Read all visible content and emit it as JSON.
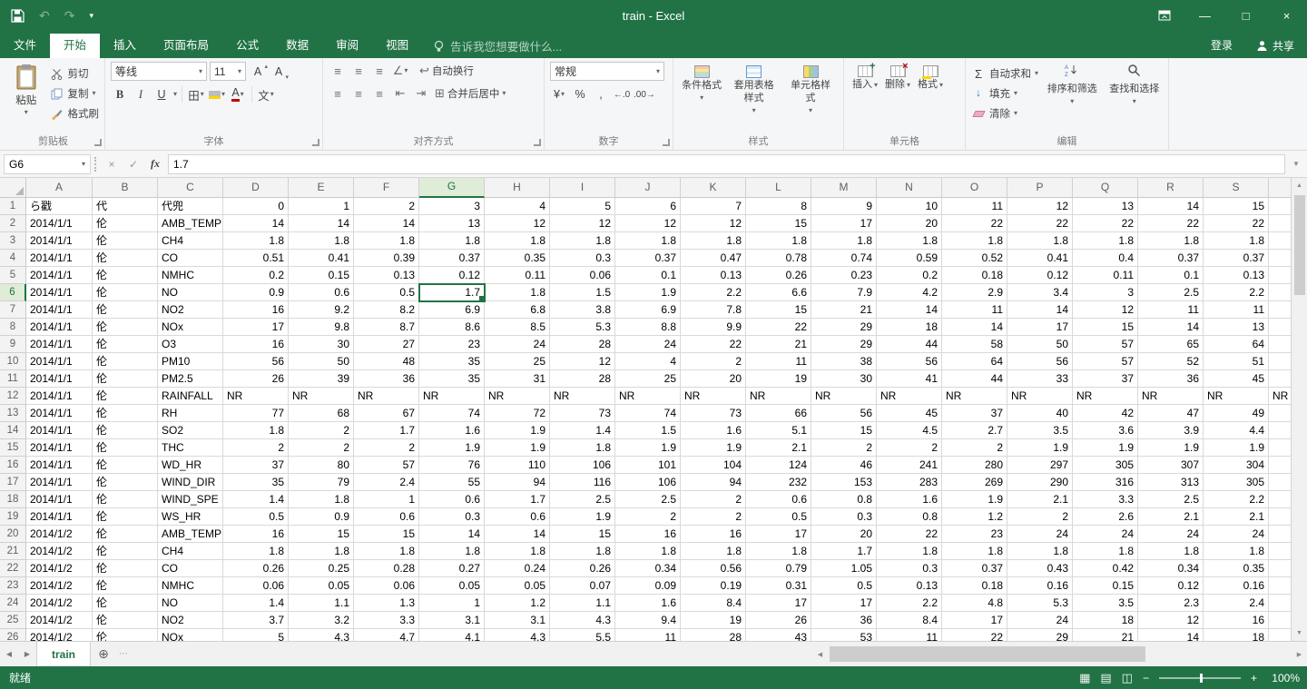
{
  "window": {
    "title": "train - Excel",
    "signin": "登录",
    "share": "共享"
  },
  "icons": {
    "chevron": "▾",
    "undo": "↶",
    "redo": "↷",
    "minimize": "—",
    "maximize": "□",
    "close": "×",
    "cancel": "×",
    "check": "✓",
    "bold": "B",
    "italic": "I",
    "underline": "U",
    "borders": "田",
    "phonetic": "文",
    "font_color_a": "A",
    "grow_font": "A",
    "shrink_font": "A",
    "align_lines": "≡",
    "orientation": "∠",
    "indent_dec": "⇤",
    "indent_inc": "⇥",
    "wrap": "↩",
    "merge": "⊞",
    "currency": "¥",
    "percent": "%",
    "comma": ",",
    "inc_decimal": "←.0",
    "dec_decimal": ".00→",
    "sum": "Σ",
    "fill_down": "↓",
    "left_arrow": "◀",
    "right_arrow": "▶",
    "up_arrow": "▲",
    "down_arrow": "▼",
    "add_sheet": "⊕",
    "ellipsis": "⋯",
    "view_normal": "▦",
    "view_layout": "▤",
    "view_break": "◫",
    "minus": "−",
    "plus": "+"
  },
  "ribbon": {
    "tabs": [
      "文件",
      "开始",
      "插入",
      "页面布局",
      "公式",
      "数据",
      "审阅",
      "视图"
    ],
    "active_tab": "开始",
    "tell_me": "告诉我您想要做什么...",
    "clipboard": {
      "label": "剪贴板",
      "paste": "粘贴",
      "cut": "剪切",
      "copy": "复制",
      "format_painter": "格式刷"
    },
    "font": {
      "label": "字体",
      "font_name": "等线",
      "font_size": "11"
    },
    "alignment": {
      "label": "对齐方式",
      "wrap_text": "自动换行",
      "merge_center": "合并后居中"
    },
    "number": {
      "label": "数字",
      "format": "常规"
    },
    "styles": {
      "label": "样式",
      "conditional": "条件格式",
      "format_as_table": "套用表格样式",
      "cell_styles": "单元格样式"
    },
    "cells": {
      "label": "单元格",
      "insert": "插入",
      "delete": "删除",
      "format": "格式"
    },
    "editing": {
      "label": "编辑",
      "autosum": "自动求和",
      "fill": "填充",
      "clear": "清除",
      "sort_filter": "排序和筛选",
      "find_select": "查找和选择"
    }
  },
  "formula_bar": {
    "name_box": "G6",
    "fx": "fx",
    "value": "1.7"
  },
  "grid": {
    "selected_cell": "G6",
    "selected_col": "G",
    "selected_row": 6,
    "columns": [
      "A",
      "B",
      "C",
      "D",
      "E",
      "F",
      "G",
      "H",
      "I",
      "J",
      "K",
      "L",
      "M",
      "N",
      "O",
      "P",
      "Q",
      "R",
      "S"
    ],
    "rows": [
      [
        "ら戳",
        "代",
        "代兜",
        "0",
        "1",
        "2",
        "3",
        "4",
        "5",
        "6",
        "7",
        "8",
        "9",
        "10",
        "11",
        "12",
        "13",
        "14",
        "15"
      ],
      [
        "2014/1/1",
        "伦",
        "AMB_TEMP",
        "14",
        "14",
        "14",
        "13",
        "12",
        "12",
        "12",
        "12",
        "15",
        "17",
        "20",
        "22",
        "22",
        "22",
        "22",
        "22"
      ],
      [
        "2014/1/1",
        "伦",
        "CH4",
        "1.8",
        "1.8",
        "1.8",
        "1.8",
        "1.8",
        "1.8",
        "1.8",
        "1.8",
        "1.8",
        "1.8",
        "1.8",
        "1.8",
        "1.8",
        "1.8",
        "1.8",
        "1.8"
      ],
      [
        "2014/1/1",
        "伦",
        "CO",
        "0.51",
        "0.41",
        "0.39",
        "0.37",
        "0.35",
        "0.3",
        "0.37",
        "0.47",
        "0.78",
        "0.74",
        "0.59",
        "0.52",
        "0.41",
        "0.4",
        "0.37",
        "0.37"
      ],
      [
        "2014/1/1",
        "伦",
        "NMHC",
        "0.2",
        "0.15",
        "0.13",
        "0.12",
        "0.11",
        "0.06",
        "0.1",
        "0.13",
        "0.26",
        "0.23",
        "0.2",
        "0.18",
        "0.12",
        "0.11",
        "0.1",
        "0.13"
      ],
      [
        "2014/1/1",
        "伦",
        "NO",
        "0.9",
        "0.6",
        "0.5",
        "1.7",
        "1.8",
        "1.5",
        "1.9",
        "2.2",
        "6.6",
        "7.9",
        "4.2",
        "2.9",
        "3.4",
        "3",
        "2.5",
        "2.2"
      ],
      [
        "2014/1/1",
        "伦",
        "NO2",
        "16",
        "9.2",
        "8.2",
        "6.9",
        "6.8",
        "3.8",
        "6.9",
        "7.8",
        "15",
        "21",
        "14",
        "11",
        "14",
        "12",
        "11",
        "11"
      ],
      [
        "2014/1/1",
        "伦",
        "NOx",
        "17",
        "9.8",
        "8.7",
        "8.6",
        "8.5",
        "5.3",
        "8.8",
        "9.9",
        "22",
        "29",
        "18",
        "14",
        "17",
        "15",
        "14",
        "13"
      ],
      [
        "2014/1/1",
        "伦",
        "O3",
        "16",
        "30",
        "27",
        "23",
        "24",
        "28",
        "24",
        "22",
        "21",
        "29",
        "44",
        "58",
        "50",
        "57",
        "65",
        "64"
      ],
      [
        "2014/1/1",
        "伦",
        "PM10",
        "56",
        "50",
        "48",
        "35",
        "25",
        "12",
        "4",
        "2",
        "11",
        "38",
        "56",
        "64",
        "56",
        "57",
        "52",
        "51"
      ],
      [
        "2014/1/1",
        "伦",
        "PM2.5",
        "26",
        "39",
        "36",
        "35",
        "31",
        "28",
        "25",
        "20",
        "19",
        "30",
        "41",
        "44",
        "33",
        "37",
        "36",
        "45"
      ],
      [
        "2014/1/1",
        "伦",
        "RAINFALL",
        "NR",
        "NR",
        "NR",
        "NR",
        "NR",
        "NR",
        "NR",
        "NR",
        "NR",
        "NR",
        "NR",
        "NR",
        "NR",
        "NR",
        "NR",
        "NR",
        "NR"
      ],
      [
        "2014/1/1",
        "伦",
        "RH",
        "77",
        "68",
        "67",
        "74",
        "72",
        "73",
        "74",
        "73",
        "66",
        "56",
        "45",
        "37",
        "40",
        "42",
        "47",
        "49"
      ],
      [
        "2014/1/1",
        "伦",
        "SO2",
        "1.8",
        "2",
        "1.7",
        "1.6",
        "1.9",
        "1.4",
        "1.5",
        "1.6",
        "5.1",
        "15",
        "4.5",
        "2.7",
        "3.5",
        "3.6",
        "3.9",
        "4.4"
      ],
      [
        "2014/1/1",
        "伦",
        "THC",
        "2",
        "2",
        "2",
        "1.9",
        "1.9",
        "1.8",
        "1.9",
        "1.9",
        "2.1",
        "2",
        "2",
        "2",
        "1.9",
        "1.9",
        "1.9",
        "1.9"
      ],
      [
        "2014/1/1",
        "伦",
        "WD_HR",
        "37",
        "80",
        "57",
        "76",
        "110",
        "106",
        "101",
        "104",
        "124",
        "46",
        "241",
        "280",
        "297",
        "305",
        "307",
        "304"
      ],
      [
        "2014/1/1",
        "伦",
        "WIND_DIR",
        "35",
        "79",
        "2.4",
        "55",
        "94",
        "116",
        "106",
        "94",
        "232",
        "153",
        "283",
        "269",
        "290",
        "316",
        "313",
        "305"
      ],
      [
        "2014/1/1",
        "伦",
        "WIND_SPE",
        "1.4",
        "1.8",
        "1",
        "0.6",
        "1.7",
        "2.5",
        "2.5",
        "2",
        "0.6",
        "0.8",
        "1.6",
        "1.9",
        "2.1",
        "3.3",
        "2.5",
        "2.2"
      ],
      [
        "2014/1/1",
        "伦",
        "WS_HR",
        "0.5",
        "0.9",
        "0.6",
        "0.3",
        "0.6",
        "1.9",
        "2",
        "2",
        "0.5",
        "0.3",
        "0.8",
        "1.2",
        "2",
        "2.6",
        "2.1",
        "2.1"
      ],
      [
        "2014/1/2",
        "伦",
        "AMB_TEMP",
        "16",
        "15",
        "15",
        "14",
        "14",
        "15",
        "16",
        "16",
        "17",
        "20",
        "22",
        "23",
        "24",
        "24",
        "24",
        "24"
      ],
      [
        "2014/1/2",
        "伦",
        "CH4",
        "1.8",
        "1.8",
        "1.8",
        "1.8",
        "1.8",
        "1.8",
        "1.8",
        "1.8",
        "1.8",
        "1.7",
        "1.8",
        "1.8",
        "1.8",
        "1.8",
        "1.8",
        "1.8"
      ],
      [
        "2014/1/2",
        "伦",
        "CO",
        "0.26",
        "0.25",
        "0.28",
        "0.27",
        "0.24",
        "0.26",
        "0.34",
        "0.56",
        "0.79",
        "1.05",
        "0.3",
        "0.37",
        "0.43",
        "0.42",
        "0.34",
        "0.35"
      ],
      [
        "2014/1/2",
        "伦",
        "NMHC",
        "0.06",
        "0.05",
        "0.06",
        "0.05",
        "0.05",
        "0.07",
        "0.09",
        "0.19",
        "0.31",
        "0.5",
        "0.13",
        "0.18",
        "0.16",
        "0.15",
        "0.12",
        "0.16"
      ],
      [
        "2014/1/2",
        "伦",
        "NO",
        "1.4",
        "1.1",
        "1.3",
        "1",
        "1.2",
        "1.1",
        "1.6",
        "8.4",
        "17",
        "17",
        "2.2",
        "4.8",
        "5.3",
        "3.5",
        "2.3",
        "2.4"
      ],
      [
        "2014/1/2",
        "伦",
        "NO2",
        "3.7",
        "3.2",
        "3.3",
        "3.1",
        "3.1",
        "4.3",
        "9.4",
        "19",
        "26",
        "36",
        "8.4",
        "17",
        "24",
        "18",
        "12",
        "16"
      ],
      [
        "2014/1/2",
        "伦",
        "NOx",
        "5",
        "4.3",
        "4.7",
        "4.1",
        "4.3",
        "5.5",
        "11",
        "28",
        "43",
        "53",
        "11",
        "22",
        "29",
        "21",
        "14",
        "18"
      ]
    ]
  },
  "sheet_tabs": {
    "active": "train"
  },
  "status_bar": {
    "ready": "就绪",
    "zoom": "100%"
  }
}
